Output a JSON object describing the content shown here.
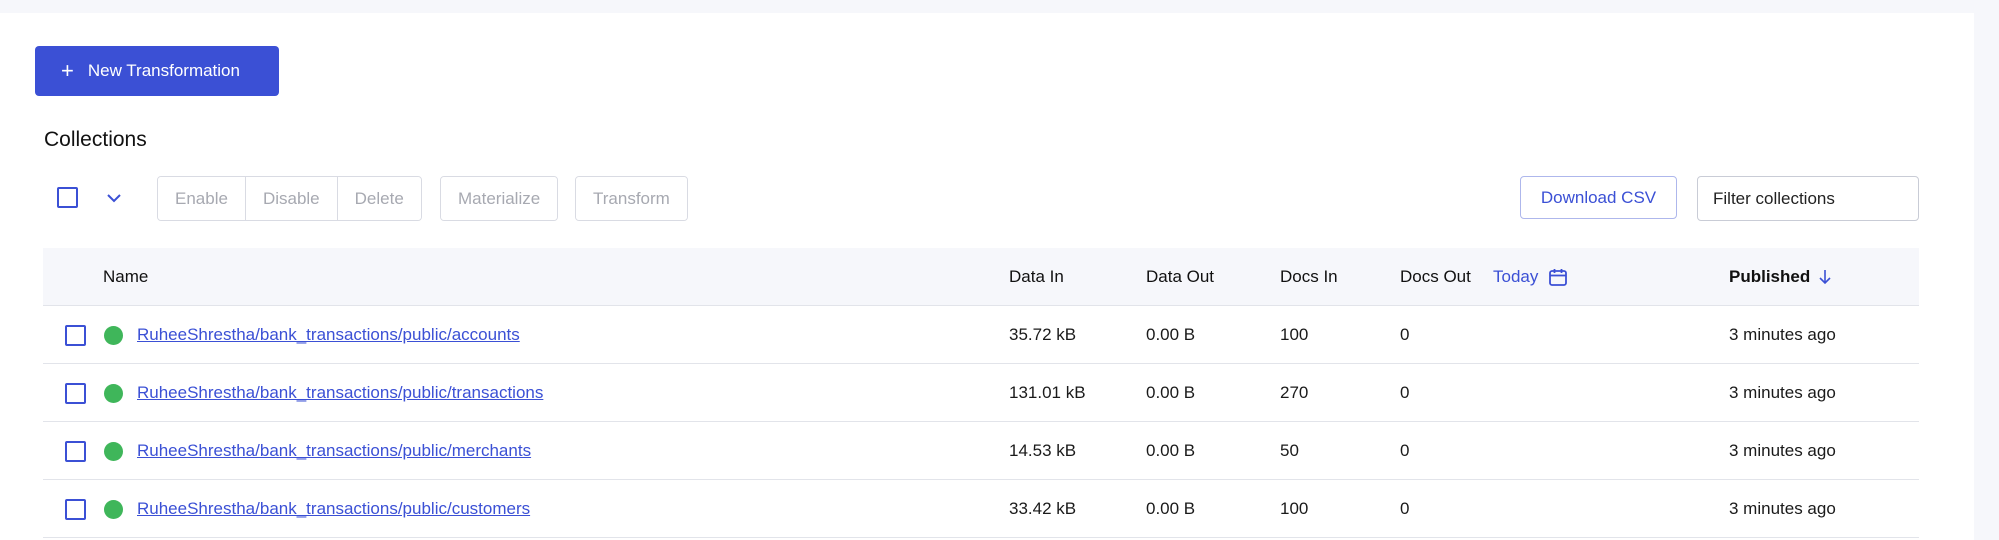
{
  "toolbar": {
    "new_transformation_label": "New Transformation"
  },
  "section": {
    "title": "Collections"
  },
  "bulk_actions": {
    "group1": [
      "Enable",
      "Disable",
      "Delete"
    ],
    "materialize_label": "Materialize",
    "transform_label": "Transform"
  },
  "download_csv_label": "Download CSV",
  "filter": {
    "placeholder": "Filter collections"
  },
  "table": {
    "headers": {
      "name": "Name",
      "data_in": "Data In",
      "data_out": "Data Out",
      "docs_in": "Docs In",
      "docs_out": "Docs Out",
      "date_range": "Today",
      "published": "Published"
    },
    "sort": {
      "column": "Published",
      "direction": "descending"
    },
    "rows": [
      {
        "name": "RuheeShrestha/bank_transactions/public/accounts",
        "status_color": "#3fb65a",
        "data_in": "35.72 kB",
        "data_out": "0.00 B",
        "docs_in": "100",
        "docs_out": "0",
        "published": "3 minutes ago"
      },
      {
        "name": "RuheeShrestha/bank_transactions/public/transactions",
        "status_color": "#3fb65a",
        "data_in": "131.01 kB",
        "data_out": "0.00 B",
        "docs_in": "270",
        "docs_out": "0",
        "published": "3 minutes ago"
      },
      {
        "name": "RuheeShrestha/bank_transactions/public/merchants",
        "status_color": "#3fb65a",
        "data_in": "14.53 kB",
        "data_out": "0.00 B",
        "docs_in": "50",
        "docs_out": "0",
        "published": "3 minutes ago"
      },
      {
        "name": "RuheeShrestha/bank_transactions/public/customers",
        "status_color": "#3fb65a",
        "data_in": "33.42 kB",
        "data_out": "0.00 B",
        "docs_in": "100",
        "docs_out": "0",
        "published": "3 minutes ago"
      }
    ]
  },
  "colors": {
    "accent": "#3b50d5",
    "status_ok": "#3fb65a"
  }
}
